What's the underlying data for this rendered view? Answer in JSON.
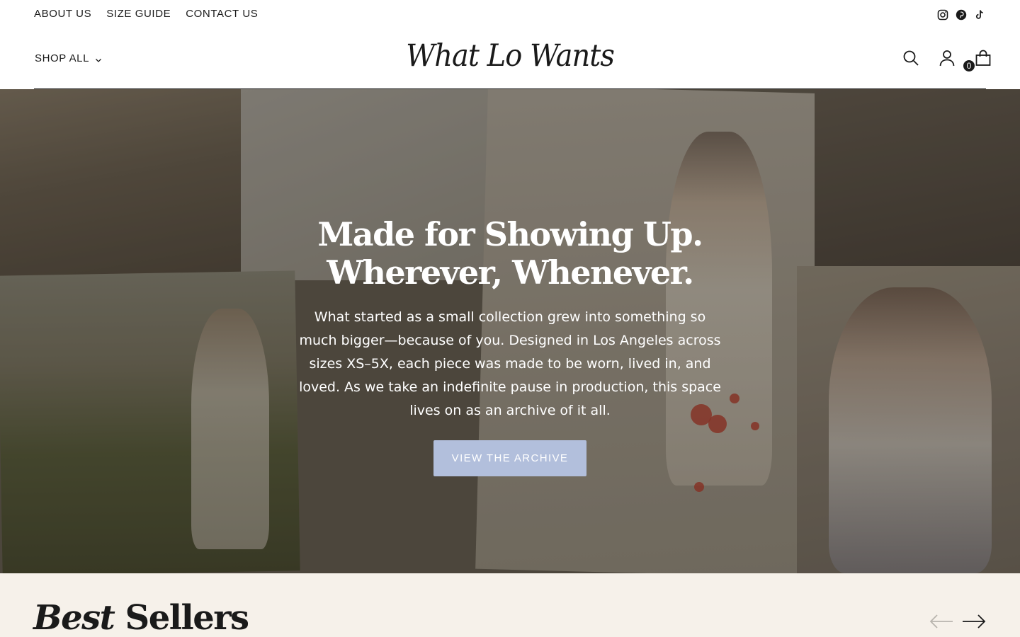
{
  "util_nav": [
    "About Us",
    "Size Guide",
    "Contact Us"
  ],
  "socials": [
    "instagram-icon",
    "pinterest-icon",
    "tiktok-icon"
  ],
  "header": {
    "shop_all": "Shop All",
    "logo": "What Lo Wants",
    "cart_count": "0"
  },
  "hero": {
    "title_line1": "Made for Showing Up.",
    "title_line2": "Wherever, Whenever.",
    "body": "What started as a small collection grew into something so much bigger—because of you. Designed in Los Angeles across sizes XS–5X, each piece was made to be worn, lived in, and loved. As we take an indefinite pause in production, this space lives on as an archive of it all.",
    "button": "View the Archive",
    "button_color": "#b2bfdc"
  },
  "best_sellers": {
    "title_italic": "Best",
    "title_rest": "Sellers"
  },
  "colors": {
    "text": "#1a1a1a",
    "section_bg": "#f6f1ea"
  }
}
